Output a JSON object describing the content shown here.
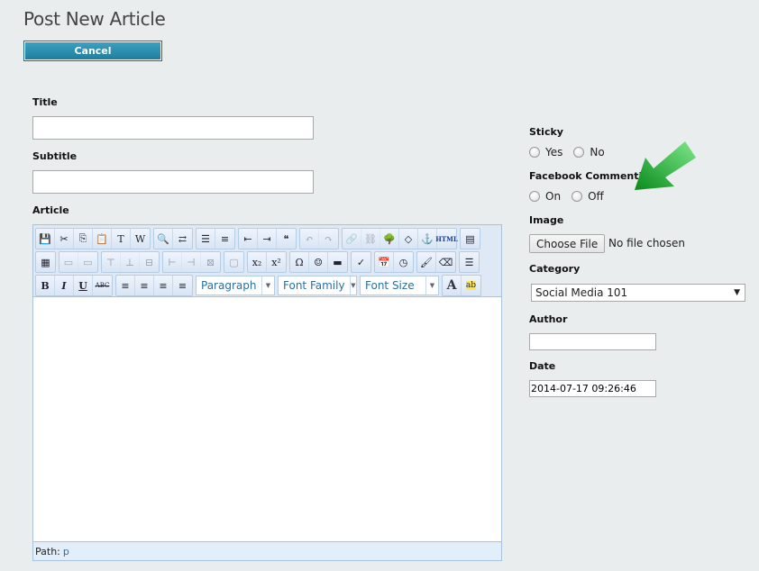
{
  "page": {
    "title": "Post New Article"
  },
  "actions": {
    "cancel_label": "Cancel"
  },
  "form": {
    "title": {
      "label": "Title",
      "value": ""
    },
    "subtitle": {
      "label": "Subtitle",
      "value": ""
    },
    "article": {
      "label": "Article"
    }
  },
  "editor": {
    "toolbar_row1": [
      {
        "name": "save-icon",
        "glyph": "💾"
      },
      {
        "name": "cut-icon",
        "glyph": "✂"
      },
      {
        "name": "copy-icon",
        "glyph": "⎘"
      },
      {
        "name": "paste-icon",
        "glyph": "📋"
      },
      {
        "name": "paste-text-icon",
        "glyph": "T"
      },
      {
        "name": "paste-word-icon",
        "glyph": "W"
      },
      {
        "name": "find-icon",
        "glyph": "🔍"
      },
      {
        "name": "replace-icon",
        "glyph": "⇄"
      },
      {
        "name": "bullet-list-icon",
        "glyph": "☰"
      },
      {
        "name": "numbered-list-icon",
        "glyph": "≡"
      },
      {
        "name": "outdent-icon",
        "glyph": "⇤"
      },
      {
        "name": "indent-icon",
        "glyph": "⇥"
      },
      {
        "name": "blockquote-icon",
        "glyph": "❝"
      },
      {
        "name": "undo-icon",
        "glyph": "↶"
      },
      {
        "name": "redo-icon",
        "glyph": "↷"
      },
      {
        "name": "link-icon",
        "glyph": "🔗"
      },
      {
        "name": "unlink-icon",
        "glyph": "⛓"
      },
      {
        "name": "image-icon",
        "glyph": "🌳"
      },
      {
        "name": "code-icon",
        "glyph": "◇"
      },
      {
        "name": "anchor-icon",
        "glyph": "⚓"
      },
      {
        "name": "html-icon",
        "glyph": "HTML"
      },
      {
        "name": "fullscreen-icon",
        "glyph": "▤"
      }
    ],
    "toolbar_row2": [
      {
        "name": "table-icon",
        "glyph": "▦"
      },
      {
        "name": "row-props-icon",
        "glyph": "▭"
      },
      {
        "name": "cell-props-icon",
        "glyph": "▭"
      },
      {
        "name": "insert-row-before-icon",
        "glyph": "⊤"
      },
      {
        "name": "insert-row-after-icon",
        "glyph": "⊥"
      },
      {
        "name": "delete-row-icon",
        "glyph": "⊟"
      },
      {
        "name": "insert-col-before-icon",
        "glyph": "⊢"
      },
      {
        "name": "insert-col-after-icon",
        "glyph": "⊣"
      },
      {
        "name": "delete-col-icon",
        "glyph": "⊠"
      },
      {
        "name": "merge-cells-icon",
        "glyph": "▢"
      },
      {
        "name": "subscript-icon",
        "glyph": "x₂"
      },
      {
        "name": "superscript-icon",
        "glyph": "x²"
      },
      {
        "name": "special-char-icon",
        "glyph": "Ω"
      },
      {
        "name": "emoticon-icon",
        "glyph": "☺"
      },
      {
        "name": "horizontal-rule-icon",
        "glyph": "▬"
      },
      {
        "name": "spellcheck-icon",
        "glyph": "✓"
      },
      {
        "name": "insert-date-icon",
        "glyph": "📅"
      },
      {
        "name": "insert-time-icon",
        "glyph": "◷"
      },
      {
        "name": "cleanup-icon",
        "glyph": "🖌"
      },
      {
        "name": "remove-format-icon",
        "glyph": "⌫"
      },
      {
        "name": "page-break-icon",
        "glyph": "☰"
      }
    ],
    "toolbar_row3_format": [
      {
        "name": "bold-icon",
        "glyph": "B"
      },
      {
        "name": "italic-icon",
        "glyph": "I"
      },
      {
        "name": "underline-icon",
        "glyph": "U"
      },
      {
        "name": "strikethrough-icon",
        "glyph": "ABC"
      },
      {
        "name": "align-left-icon",
        "glyph": "≡"
      },
      {
        "name": "align-center-icon",
        "glyph": "≡"
      },
      {
        "name": "align-right-icon",
        "glyph": "≡"
      },
      {
        "name": "align-justify-icon",
        "glyph": "≡"
      }
    ],
    "selects": {
      "block_format": "Paragraph",
      "font_family": "Font Family",
      "font_size": "Font Size"
    },
    "toolbar_row3_color": [
      {
        "name": "text-color-icon",
        "glyph": "A"
      },
      {
        "name": "highlight-color-icon",
        "glyph": "ab"
      }
    ],
    "status": {
      "path_label": "Path:",
      "path_value": "p"
    }
  },
  "sidebar": {
    "sticky": {
      "label": "Sticky",
      "options": [
        "Yes",
        "No"
      ]
    },
    "facebook": {
      "label": "Facebook Commenting",
      "options": [
        "On",
        "Off"
      ]
    },
    "image": {
      "label": "Image",
      "button": "Choose File",
      "status": "No file chosen"
    },
    "category": {
      "label": "Category",
      "selected": "Social Media 101"
    },
    "author": {
      "label": "Author",
      "value": ""
    },
    "date": {
      "label": "Date",
      "value": "2014-07-17 09:26:46"
    }
  },
  "annotation": {
    "arrow_color": "#1a9a2a"
  }
}
